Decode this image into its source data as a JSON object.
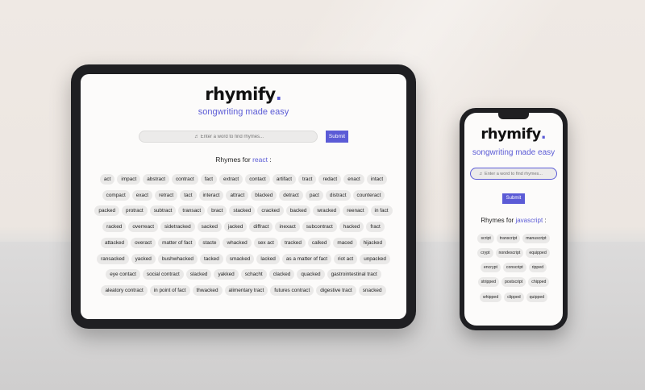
{
  "tablet": {
    "brand": "rhymify",
    "brand_dot": ".",
    "tagline": "songwriting made easy",
    "search": {
      "icon": "music-note-icon",
      "placeholder": "♬ Enter a word to find rhymes..."
    },
    "submit_label": "Submit",
    "rhymes_prefix": "Rhymes for ",
    "rhymes_word": "react",
    "rhymes_suffix": " :",
    "chips": [
      "act",
      "impact",
      "abstract",
      "contract",
      "fact",
      "extract",
      "contact",
      "artifact",
      "tract",
      "redact",
      "enact",
      "intact",
      "compact",
      "exact",
      "retract",
      "tact",
      "interact",
      "attract",
      "blacked",
      "detract",
      "pact",
      "distract",
      "counteract",
      "packed",
      "protract",
      "subtract",
      "transact",
      "bract",
      "stacked",
      "cracked",
      "backed",
      "wracked",
      "reenact",
      "in fact",
      "racked",
      "overreact",
      "sidetracked",
      "sacked",
      "jacked",
      "diffract",
      "inexact",
      "subcontract",
      "hacked",
      "fract",
      "attacked",
      "overact",
      "matter of fact",
      "stacte",
      "whacked",
      "sex act",
      "tracked",
      "calked",
      "maced",
      "hijacked",
      "ransacked",
      "yacked",
      "bushwhacked",
      "tacked",
      "smacked",
      "lacked",
      "as a matter of fact",
      "riot act",
      "unpacked",
      "eye contact",
      "social contract",
      "slacked",
      "yakked",
      "schacht",
      "clacked",
      "quacked",
      "gastrointestinal tract",
      "aleatory contract",
      "in point of fact",
      "thwacked",
      "alimentary tract",
      "futures contract",
      "digestive tract",
      "snacked"
    ]
  },
  "phone": {
    "brand": "rhymify",
    "brand_dot": ".",
    "tagline": "songwriting made easy",
    "search": {
      "icon": "music-note-icon",
      "placeholder": "♬ Enter a word to find rhymes..."
    },
    "submit_label": "Submit",
    "rhymes_prefix": "Rhymes for ",
    "rhymes_word": "javascript",
    "rhymes_suffix": " :",
    "chips": [
      "script",
      "transcript",
      "manuscript",
      "crypt",
      "nondescript",
      "equipped",
      "encrypt",
      "conscript",
      "ripped",
      "stripped",
      "postscript",
      "chipped",
      "whipped",
      "clipped",
      "quipped"
    ]
  },
  "colors": {
    "accent": "#5b5bd6",
    "device_frame": "#1f1f22",
    "chip_bg": "#eae9e8"
  }
}
